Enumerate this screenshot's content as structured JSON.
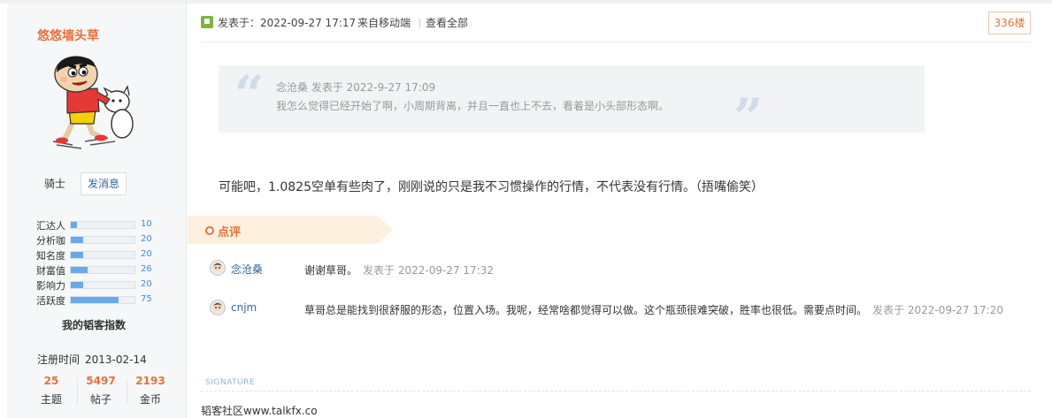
{
  "user": {
    "name": "悠悠墙头草",
    "rank": "骑士",
    "message_button": "发消息",
    "stats": [
      {
        "label": "汇达人",
        "value": "10",
        "fraction": 0.1
      },
      {
        "label": "分析咖",
        "value": "20",
        "fraction": 0.2
      },
      {
        "label": "知名度",
        "value": "20",
        "fraction": 0.2
      },
      {
        "label": "财富值",
        "value": "26",
        "fraction": 0.26
      },
      {
        "label": "影响力",
        "value": "20",
        "fraction": 0.2
      },
      {
        "label": "活跃度",
        "value": "75",
        "fraction": 0.75
      }
    ],
    "stats_caption": "我的韬客指数",
    "registered_label": "注册时间",
    "registered_date": "2013-02-14",
    "counts": [
      {
        "value": "25",
        "label": "主题"
      },
      {
        "value": "5497",
        "label": "帖子"
      },
      {
        "value": "2193",
        "label": "金币"
      }
    ]
  },
  "post": {
    "posted_at": "发表于：2022-09-27 17:17",
    "source": "来自移动端",
    "view_all": "查看全部",
    "floor": "336楼",
    "quote": {
      "author_line": "念沧桑 发表于 2022-9-27 17:09",
      "text": "我怎么觉得已经开始了啊，小周期背离，并且一直也上不去，看着是小头部形态啊。",
      "open_mark": "“",
      "close_mark": "”"
    },
    "body": "可能吧，1.0825空单有些肉了，刚刚说的只是我不习惯操作的行情，不代表没有行情。（捂嘴偷笑）"
  },
  "reviews": {
    "title": "点评",
    "items": [
      {
        "user": "念沧桑",
        "text": "谢谢草哥。",
        "time": "发表于 2022-09-27 17:32"
      },
      {
        "user": "cnjm",
        "text": "草哥总是能找到很舒服的形态，位置入场。我呢，经常啥都觉得可以做。这个瓶颈很难突破，胜率也很低。需要点时间。",
        "time": "发表于 2022-09-27 17:20"
      }
    ]
  },
  "signature": {
    "label": "SIGNATURE",
    "text": "韬客社区www.talkfx.co"
  },
  "colors": {
    "accent_orange": "#e8703a",
    "link_blue": "#336699",
    "bar_blue": "#6aa9e9",
    "review_bg": "#fdf0de"
  }
}
